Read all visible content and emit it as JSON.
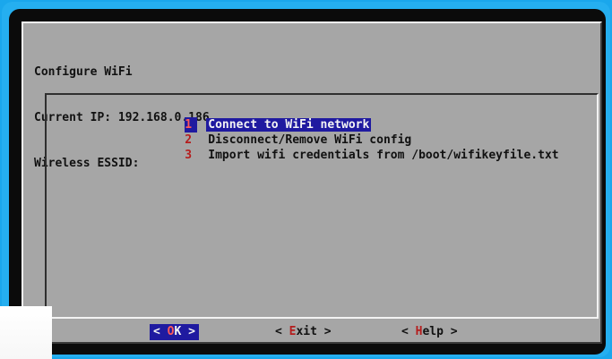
{
  "dialog": {
    "title": "Configure WiFi",
    "current_ip": "Current IP: 192.168.0.186",
    "wireless_essid": "Wireless ESSID:"
  },
  "menu": {
    "items": [
      {
        "number": "1",
        "label": "Connect to WiFi network",
        "selected": true
      },
      {
        "number": "2",
        "label": "Disconnect/Remove WiFi config",
        "selected": false
      },
      {
        "number": "3",
        "label": "Import wifi credentials from /boot/wifikeyfile.txt",
        "selected": false
      }
    ]
  },
  "buttons": {
    "ok": {
      "left": "< ",
      "hot": "O",
      "rest": "K",
      "right": " >",
      "selected": true
    },
    "exit": {
      "left": "< ",
      "hot": "E",
      "rest": "xit",
      "right": " >",
      "selected": false
    },
    "help": {
      "left": "< ",
      "hot": "H",
      "rest": "elp",
      "right": " >",
      "selected": false
    }
  },
  "colors": {
    "frame": "#25aff0",
    "dialog_bg": "#a6a6a6",
    "selection_bg": "#1f1aa0",
    "hotkey": "#b51d1d"
  }
}
